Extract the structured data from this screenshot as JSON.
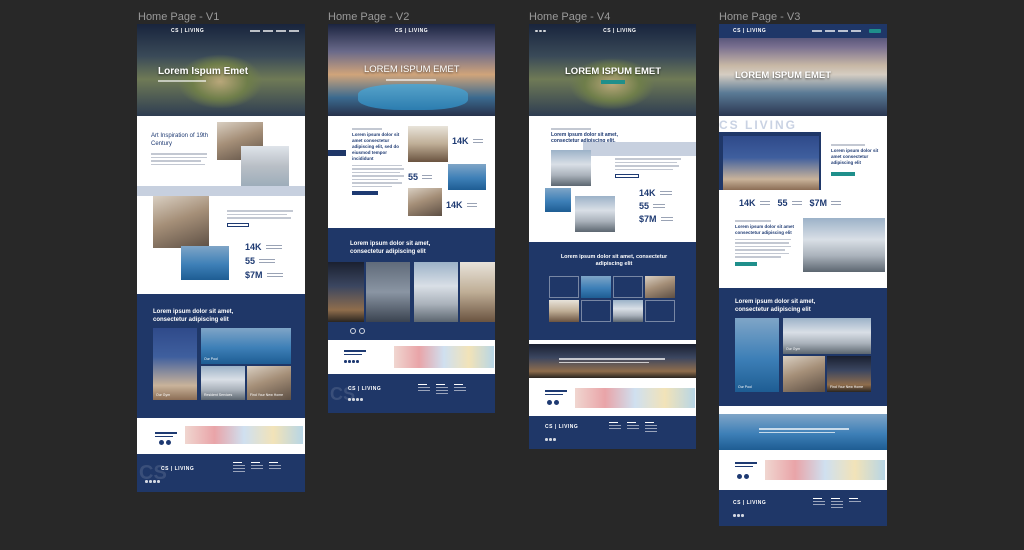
{
  "canvas": {
    "background": "#282828",
    "accent_navy": "#1f3768",
    "accent_teal": "#1f8f8b"
  },
  "frames": [
    {
      "label": "Home Page - V1",
      "brand": "CS | LIVING"
    },
    {
      "label": "Home Page -  V2",
      "brand": "CS | LIVING"
    },
    {
      "label": "Home Page - V4",
      "brand": "CS | LIVING"
    },
    {
      "label": "Home Page - V3",
      "brand": "CS | LIVING"
    }
  ],
  "v1": {
    "hero_title": "Lorem Ispum Emet",
    "heading": "Art Inspiration of 19th Century",
    "stats": [
      {
        "num": "14K"
      },
      {
        "num": "55"
      },
      {
        "num": "$7M"
      }
    ],
    "navy_heading": "Lorem ipsum dolor sit amet, consectetur adipiscing elit",
    "cards": [
      "Our Gym",
      "Our Pool",
      "Resident Services",
      "Find Your New Home"
    ],
    "footer_brand": "CS | LIVING"
  },
  "v2": {
    "hero_title": "LOREM ISPUM EMET",
    "heading": "Lorem ipsum dolor sit amet consectetur adipiscing elit, sed do eiusmod tempor incididunt",
    "stats": [
      {
        "num": "14K"
      },
      {
        "num": "55"
      },
      {
        "num": "14K"
      }
    ],
    "navy_heading": "Lorem ipsum dolor sit amet, consectetur adipiscing elit",
    "footer_brand": "CS | LIVING",
    "watermark": "CS"
  },
  "v4": {
    "hero_title": "LOREM ISPUM EMET",
    "heading": "Lorem ipsum dolor sit amet, consectetur adipiscing elit.",
    "stats": [
      {
        "num": "14K"
      },
      {
        "num": "55"
      },
      {
        "num": "$7M"
      }
    ],
    "navy_heading": "Lorem ipsum dolor sit amet, consectetur adipiscing elit",
    "footer_brand": "CS | LIVING"
  },
  "v3": {
    "hero_title": "LOREM ISPUM EMET",
    "watermark": "CS LIVING",
    "heading": "Lorem ipsum dolor sit amet consectetur adipiscing elit",
    "stats": [
      {
        "num": "14K"
      },
      {
        "num": "55"
      },
      {
        "num": "$7M"
      }
    ],
    "heading2": "Lorem ipsum dolor sit amet consectetur adipiscing elit",
    "navy_heading": "Lorem ipsum dolor sit amet, consectetur adipiscing elit",
    "cards": [
      "Our Pool",
      "Our Gym",
      "Find Your New Home"
    ],
    "footer_brand": "CS | LIVING"
  }
}
